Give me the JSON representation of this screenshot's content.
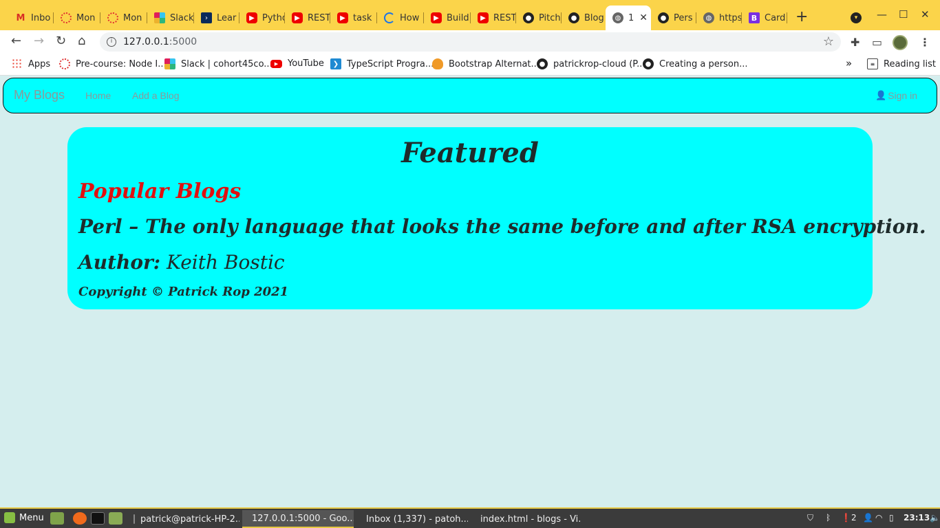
{
  "browser": {
    "tabs": [
      {
        "label": "Inbo",
        "icon": "gmail-icon"
      },
      {
        "label": "Mon",
        "icon": "moringa-icon"
      },
      {
        "label": "Mon",
        "icon": "moringa-icon"
      },
      {
        "label": "Slack",
        "icon": "slack-icon"
      },
      {
        "label": "Lear",
        "icon": "terminal-icon"
      },
      {
        "label": "Pytho",
        "icon": "youtube-icon"
      },
      {
        "label": "REST",
        "icon": "youtube-icon"
      },
      {
        "label": "task",
        "icon": "youtube-icon"
      },
      {
        "label": "How",
        "icon": "loader-icon"
      },
      {
        "label": "Build",
        "icon": "youtube-icon"
      },
      {
        "label": "REST",
        "icon": "youtube-icon"
      },
      {
        "label": "Pitch",
        "icon": "github-icon"
      },
      {
        "label": "Blog",
        "icon": "github-icon"
      },
      {
        "label": "1",
        "icon": "globe-icon",
        "active": true
      },
      {
        "label": "Pers",
        "icon": "github-icon"
      },
      {
        "label": "https",
        "icon": "globe-icon"
      },
      {
        "label": "Card",
        "icon": "bootstrap-icon"
      }
    ],
    "url_host": "127.0.0.1",
    "url_port": ":5000",
    "bookmarks": [
      {
        "label": "Apps",
        "icon": "apps-grid-icon"
      },
      {
        "label": "Pre-course: Node I...",
        "icon": "moringa-icon"
      },
      {
        "label": "Slack | cohort45co...",
        "icon": "slack-icon"
      },
      {
        "label": "YouTube",
        "icon": "youtube-icon"
      },
      {
        "label": "TypeScript Progra...",
        "icon": "vscode-icon"
      },
      {
        "label": "Bootstrap Alternat...",
        "icon": "fox-icon"
      },
      {
        "label": "patrickrop-cloud (P...",
        "icon": "github-icon"
      },
      {
        "label": "Creating a person...",
        "icon": "github-icon"
      }
    ],
    "bookmarks_overflow": "»",
    "reading_list": "Reading list"
  },
  "site": {
    "brand": "My Blogs",
    "nav": {
      "home": "Home",
      "add": "Add a Blog",
      "signin": "Sign in"
    },
    "featured": {
      "heading": "Featured",
      "popular": "Popular Blogs",
      "blog_title": "Perl – The only language that looks the same before and after RSA encryption.",
      "author_label": "Author:",
      "author_name": "Keith Bostic",
      "copyright": "Copyright © Patrick Rop 2021"
    }
  },
  "taskbar": {
    "menu": "Menu",
    "tasks": [
      {
        "label": "patrick@patrick-HP-2...",
        "icon": "terminal-icon"
      },
      {
        "label": "127.0.0.1:5000 - Goo...",
        "icon": "chrome-icon",
        "active": true
      },
      {
        "label": "Inbox (1,337) - patoh...",
        "icon": "chrome-icon"
      },
      {
        "label": "index.html - blogs - Vi...",
        "icon": "vscode-icon"
      }
    ],
    "notification_count": "2",
    "clock": "23:13"
  },
  "colors": {
    "tabstrip": "#fbd44a",
    "navbar_bg": "#00ffff",
    "page_bg": "#d5eeee",
    "popular_red": "#e01010"
  }
}
